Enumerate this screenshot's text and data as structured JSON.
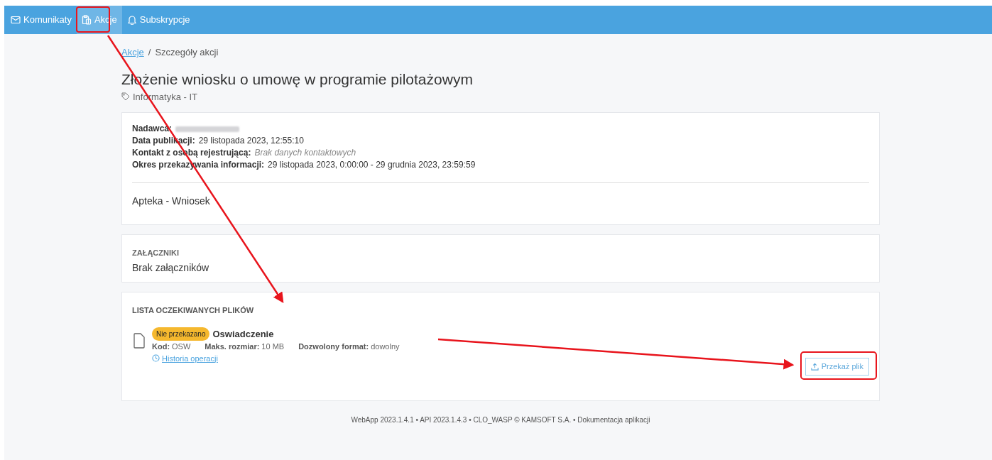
{
  "nav": {
    "items": [
      {
        "label": "Komunikaty",
        "selected": false
      },
      {
        "label": "Akcje",
        "selected": true
      },
      {
        "label": "Subskrypcje",
        "selected": false
      }
    ]
  },
  "breadcrumb": {
    "link": "Akcje",
    "separator": "/",
    "current": "Szczegóły akcji"
  },
  "title": "Złożenie wniosku o umowę w programie pilotażowym",
  "category": "Informatyka - IT",
  "details": [
    {
      "label": "Nadawca:",
      "kind": "redacted"
    },
    {
      "label": "Data publikacji:",
      "kind": "plain",
      "value": "29 listopada 2023, 12:55:10"
    },
    {
      "label": "Kontakt z osobą rejestrującą:",
      "kind": "muted",
      "value": "Brak danych kontaktowych"
    },
    {
      "label": "Okres przekazywania informacji:",
      "kind": "plain",
      "value": "29 listopada 2023, 0:00:00 - 29 grudnia 2023, 23:59:59"
    }
  ],
  "description": "Apteka - Wniosek",
  "attachments": {
    "heading": "ZAŁĄCZNIKI",
    "empty_text": "Brak załączników"
  },
  "expected_files": {
    "heading": "LISTA OCZEKIWANYCH PLIKÓW",
    "files": [
      {
        "status": "Nie przekazano",
        "name": "Oswiadczenie",
        "fields": [
          {
            "label": "Kod:",
            "value": "OSW"
          },
          {
            "label": "Maks. rozmiar:",
            "value": "10 MB"
          },
          {
            "label": "Dozwolony format:",
            "value": "dowolny"
          }
        ],
        "history_link": "Historia operacji",
        "upload_button": "Przekaż plik"
      }
    ]
  },
  "footer": "WebApp 2023.1.4.1 • API 2023.1.4.3 • CLO_WASP © KAMSOFT S.A. • Dokumentacja aplikacji"
}
